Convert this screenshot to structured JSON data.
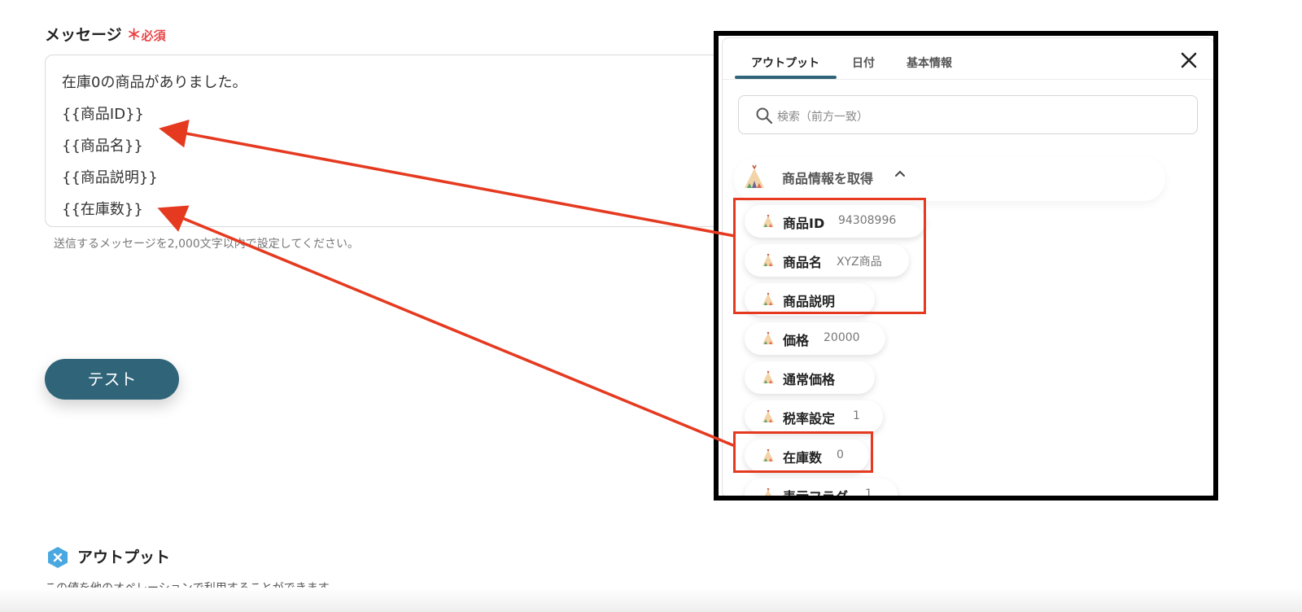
{
  "form": {
    "label": "メッセージ",
    "required_star": "＊",
    "required_text": "必須",
    "message_lines": [
      "在庫0の商品がありました。",
      "{{商品ID}}",
      "{{商品名}}",
      "{{商品説明}}",
      "{{在庫数}}"
    ],
    "helper_text": "送信するメッセージを2,000文字以内で設定してください。",
    "test_button": "テスト"
  },
  "output_section": {
    "title": "アウトプット",
    "description": "この値を他のオペレーションで利用することができます。",
    "icon": "x-hexagon-icon"
  },
  "panel": {
    "tabs": [
      "アウトプット",
      "日付",
      "基本情報"
    ],
    "active_tab": 0,
    "search_placeholder": "検索（前方一致）",
    "group_label": "商品情報を取得",
    "items": [
      {
        "label": "商品ID",
        "value": "94308996"
      },
      {
        "label": "商品名",
        "value": "XYZ商品"
      },
      {
        "label": "商品説明",
        "value": ""
      },
      {
        "label": "価格",
        "value": "20000"
      },
      {
        "label": "通常価格",
        "value": ""
      },
      {
        "label": "税率設定",
        "value": "1"
      },
      {
        "label": "在庫数",
        "value": "0"
      },
      {
        "label": "表示フラグ",
        "value": "1"
      }
    ]
  },
  "colors": {
    "primary": "#2f6479",
    "required": "#e8474a",
    "annotation": "#e53a20"
  }
}
